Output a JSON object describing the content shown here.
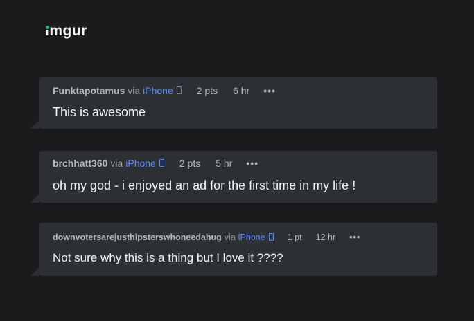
{
  "header": {
    "logo": "imgur",
    "accent_color": "#1bb76e"
  },
  "comments": [
    {
      "author": "Funktapotamus",
      "via": "via",
      "platform": "iPhone",
      "points": "2 pts",
      "time": "6 hr",
      "more": "•••",
      "text": "This is awesome"
    },
    {
      "author": "brchhatt360",
      "via": "via",
      "platform": "iPhone",
      "points": "2 pts",
      "time": "5 hr",
      "more": "•••",
      "text": "oh my god - i enjoyed an ad for the first time in my life !"
    },
    {
      "author": "downvotersarejusthipsterswhoneedahug",
      "via": "via",
      "platform": "iPhone",
      "points": "1 pt",
      "time": "12 hr",
      "more": "•••",
      "text": "Not sure why this is a thing but I love it ????"
    }
  ],
  "colors": {
    "background": "#1b1b1e",
    "card": "#2c2f34",
    "link": "#5c8cf6"
  },
  "icons": {
    "device": "phone-icon",
    "menu": "more-options-icon"
  }
}
